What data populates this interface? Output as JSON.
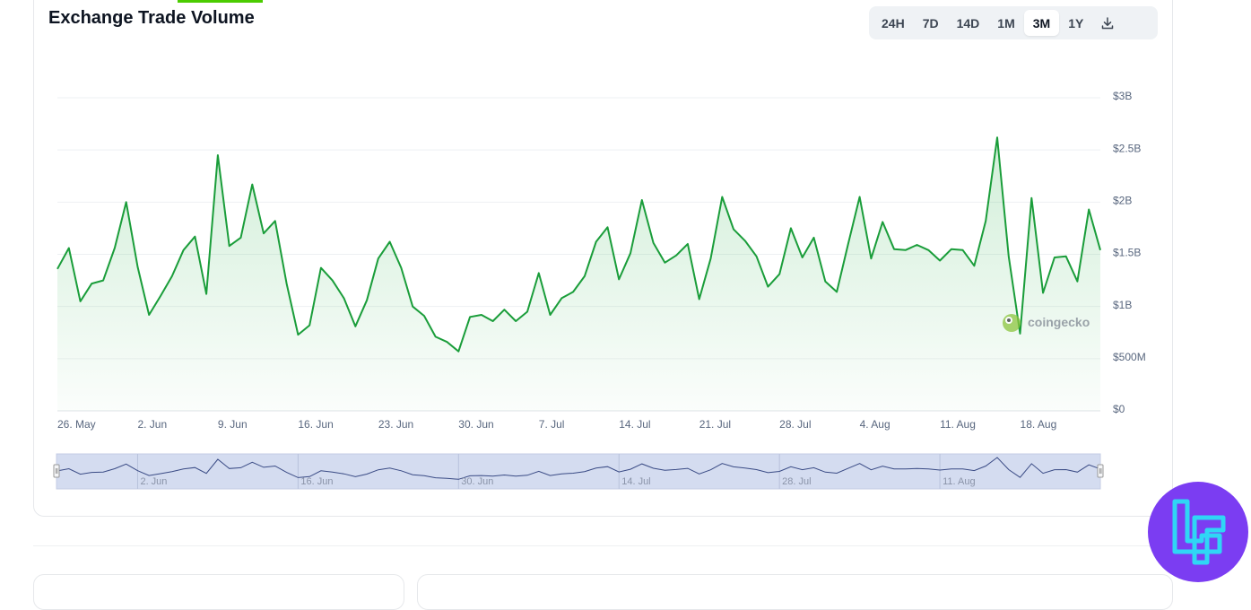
{
  "header": {
    "title": "Exchange Trade Volume"
  },
  "range_buttons": [
    "24H",
    "7D",
    "14D",
    "1M",
    "3M",
    "1Y"
  ],
  "active_range": "3M",
  "watermark": "coingecko",
  "colors": {
    "line": "#1a9d3a",
    "navigator_fill": "#d4dcf0",
    "badge": "#7b3df2",
    "badge_icon": "#2fd6f5"
  },
  "chart_data": {
    "type": "area",
    "x_start": "2025-05-25",
    "x_ticks": [
      "26. May",
      "2. Jun",
      "9. Jun",
      "16. Jun",
      "23. Jun",
      "30. Jun",
      "7. Jul",
      "14. Jul",
      "21. Jul",
      "28. Jul",
      "4. Aug",
      "11. Aug",
      "18. Aug"
    ],
    "navigator_ticks": [
      "2. Jun",
      "16. Jun",
      "30. Jun",
      "14. Jul",
      "28. Jul",
      "11. Aug"
    ],
    "y_ticks": [
      "$0",
      "$500M",
      "$1B",
      "$1.5B",
      "$2B",
      "$2.5B",
      "$3B"
    ],
    "ylim": [
      0,
      3000000000
    ],
    "grid": true,
    "series": [
      {
        "values_billion": [
          1.36,
          1.56,
          1.05,
          1.22,
          1.25,
          1.56,
          2.0,
          1.38,
          0.92,
          1.1,
          1.29,
          1.54,
          1.67,
          1.12,
          2.45,
          1.58,
          1.66,
          2.17,
          1.7,
          1.82,
          1.22,
          0.73,
          0.82,
          1.37,
          1.25,
          1.08,
          0.81,
          1.06,
          1.46,
          1.62,
          1.37,
          1.0,
          0.91,
          0.71,
          0.66,
          0.57,
          0.9,
          0.92,
          0.86,
          0.97,
          0.86,
          0.95,
          1.32,
          0.92,
          1.08,
          1.14,
          1.29,
          1.62,
          1.76,
          1.26,
          1.51,
          2.02,
          1.61,
          1.42,
          1.49,
          1.6,
          1.07,
          1.46,
          2.05,
          1.74,
          1.63,
          1.48,
          1.19,
          1.31,
          1.75,
          1.47,
          1.66,
          1.24,
          1.14,
          1.6,
          2.05,
          1.46,
          1.81,
          1.55,
          1.54,
          1.59,
          1.54,
          1.44,
          1.55,
          1.54,
          1.39,
          1.82,
          2.62,
          1.48,
          0.74,
          2.04,
          1.13,
          1.47,
          1.48,
          1.24,
          1.93,
          1.54
        ]
      }
    ]
  }
}
